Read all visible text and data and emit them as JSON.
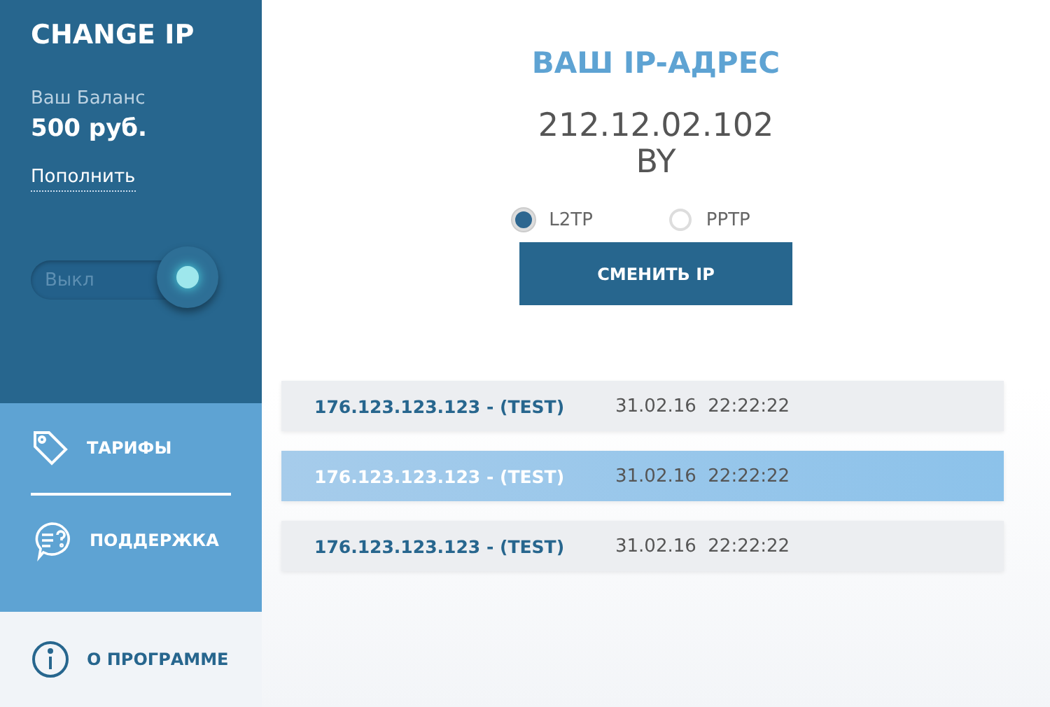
{
  "sidebar": {
    "title": "CHANGE IP",
    "balance_label": "Ваш Баланс",
    "balance": "500 руб.",
    "topup_link": "Пополнить",
    "toggle": {
      "label": "Выкл",
      "on": false
    },
    "nav": [
      {
        "label": "ТАРИФЫ",
        "kind": "tag",
        "selected": false
      },
      {
        "label": "ПОДДЕРЖКА",
        "kind": "support",
        "selected": false
      },
      {
        "label": "О ПРОГРАММЕ",
        "kind": "info",
        "selected": true
      }
    ]
  },
  "main": {
    "heading": "ВАШ IP-АДРЕС",
    "ip": "212.12.02.102",
    "country": "BY",
    "protocols": [
      {
        "label": "L2TP",
        "selected": true
      },
      {
        "label": "PPTP",
        "selected": false
      }
    ],
    "button": "СМЕНИТЬ IP",
    "history": [
      {
        "address": "176.123.123.123 - (TEST)",
        "time": "31.02.16  22:22:22",
        "selected": false
      },
      {
        "address": "176.123.123.123 - (TEST)",
        "time": "31.02.16  22:22:22",
        "selected": true
      },
      {
        "address": "176.123.123.123 - (TEST)",
        "time": "31.02.16  22:22:22",
        "selected": false
      }
    ]
  }
}
